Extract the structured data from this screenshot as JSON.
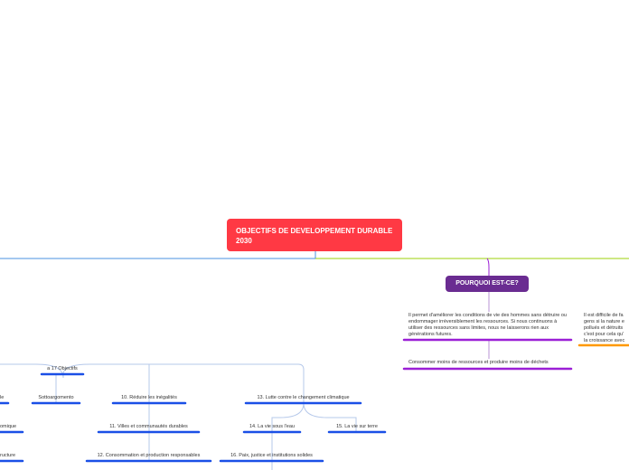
{
  "root": {
    "title": "OBJECTIFS DE DEVELOPPEMENT DURABLE 2030"
  },
  "why": {
    "title": "POURQUOI EST-CE?",
    "description": "Il permet d'améliorer les conditions de vie des hommes sans détruire ou endommager irréversiblement les ressources. Si nous continuons à utiliser des ressources sans limites, nous ne laisserons rien aux générations futures.",
    "consume": "Consommer moins de ressources et produire moins de déchets",
    "side_lines": [
      "Il est difficile de fa",
      "gens si la nature e",
      "pollués et détruits",
      "c'est pour cela qu'",
      "la croissance avec"
    ]
  },
  "objectives": {
    "header": "a 17 Objectifs",
    "frag_top": "le",
    "frag_mid": "omique",
    "frag_bottom": "ructure",
    "items": {
      "sottoargomento": "Sottoargomento",
      "o10": "10. Réduire les inégalités",
      "o11": "11. Villes et communautés durables",
      "o12": "12. Consommation et production responsables",
      "o13": "13. Lutte contre le changement climatique",
      "o14": "14. La vie sous l'eau",
      "o15": "15. La vie sur terre",
      "o16": "16. Paix, justice et institutions solides"
    }
  },
  "colors": {
    "root": "#ff3944",
    "why": "#6a2c91",
    "purple_line": "#9b1fd6",
    "orange_line": "#ff9900",
    "blue_line": "#1a4fe6",
    "left_connector": "#4a90e2",
    "right_connector": "#9ed20a",
    "tree_connector": "#b5c8ea"
  }
}
